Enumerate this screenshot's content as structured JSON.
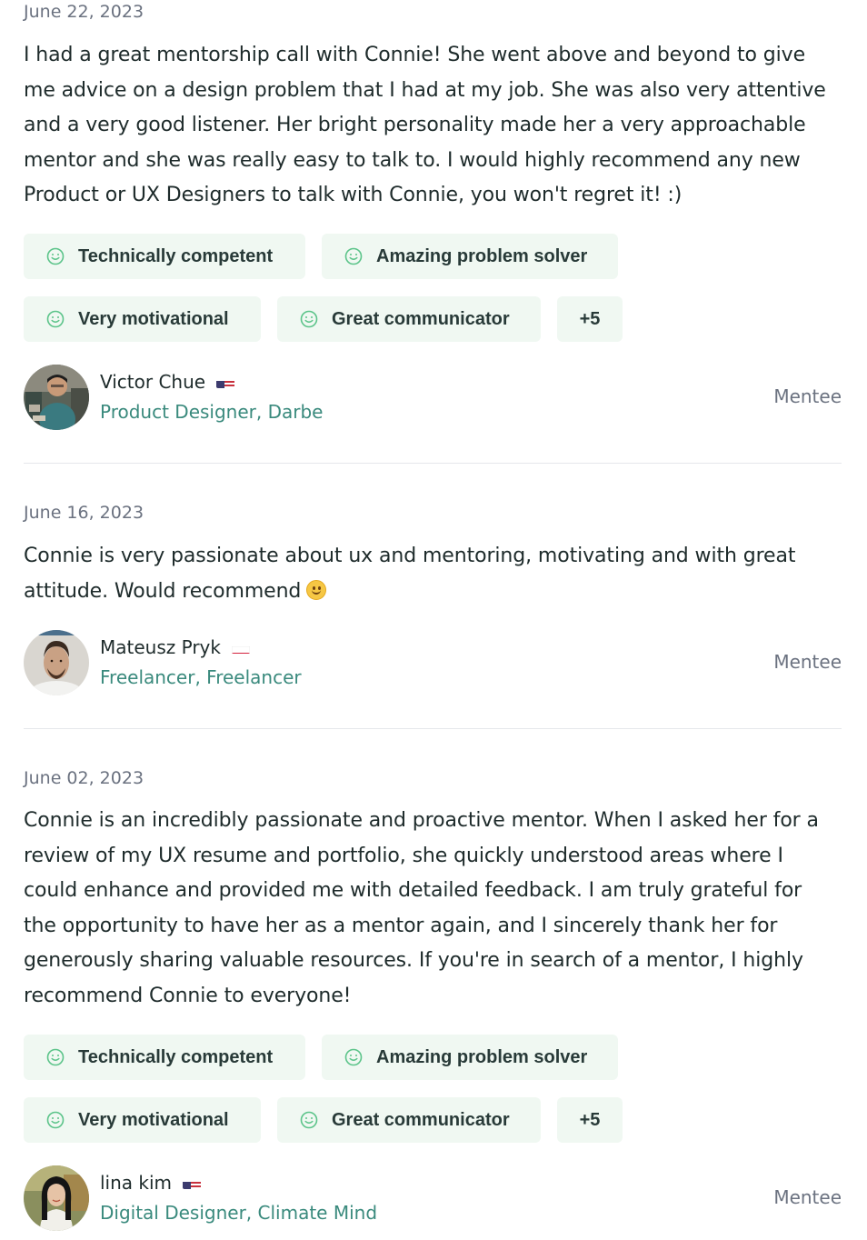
{
  "reviews": [
    {
      "date": "June 22, 2023",
      "lines": [
        "I had a great mentorship call with Connie! She went above and beyond to give",
        "me advice on a design problem that I had at my job. She was also very attentive",
        "and a very good listener. Her bright personality made her a very approachable",
        "mentor and she was really easy to talk to. I would highly recommend any new",
        "Product or UX Designers to talk with Connie, you won't regret it! :)"
      ],
      "tags": [
        "Technically competent",
        "Amazing problem solver",
        "Very motivational",
        "Great communicator"
      ],
      "more": "+5",
      "author": {
        "name": "Victor Chue",
        "flag": "us-flag-icon",
        "role": "Product Designer, Darbe",
        "type": "Mentee"
      }
    },
    {
      "date": "June 16, 2023",
      "lines": [
        "Connie is very passionate about ux and mentoring, motivating and with great",
        "attitude. Would recommend"
      ],
      "emoji": "slightly-smiling-face-icon",
      "author": {
        "name": "Mateusz Pryk",
        "flag": "pl-flag-icon",
        "role": "Freelancer, Freelancer",
        "type": "Mentee"
      }
    },
    {
      "date": "June 02, 2023",
      "lines": [
        "Connie is an incredibly passionate and proactive mentor. When I asked her for a",
        "review of my UX resume and portfolio, she quickly understood areas where I",
        "could enhance and provided me with detailed feedback. I am truly grateful for",
        "the opportunity to have her as a mentor again, and I sincerely thank her for",
        "generously sharing valuable resources. If you're in search of a mentor, I highly",
        "recommend Connie to everyone!"
      ],
      "tags": [
        "Technically competent",
        "Amazing problem solver",
        "Very motivational",
        "Great communicator"
      ],
      "more": "+5",
      "author": {
        "name": "lina kim",
        "flag": "us-flag-icon",
        "role": "Digital Designer, Climate Mind",
        "type": "Mentee"
      }
    }
  ],
  "colors": {
    "tag_bg": "#f0f8f2",
    "tag_icon": "#5cc48a",
    "role_text": "#3a8a7d",
    "divider": "#e5e7eb"
  }
}
